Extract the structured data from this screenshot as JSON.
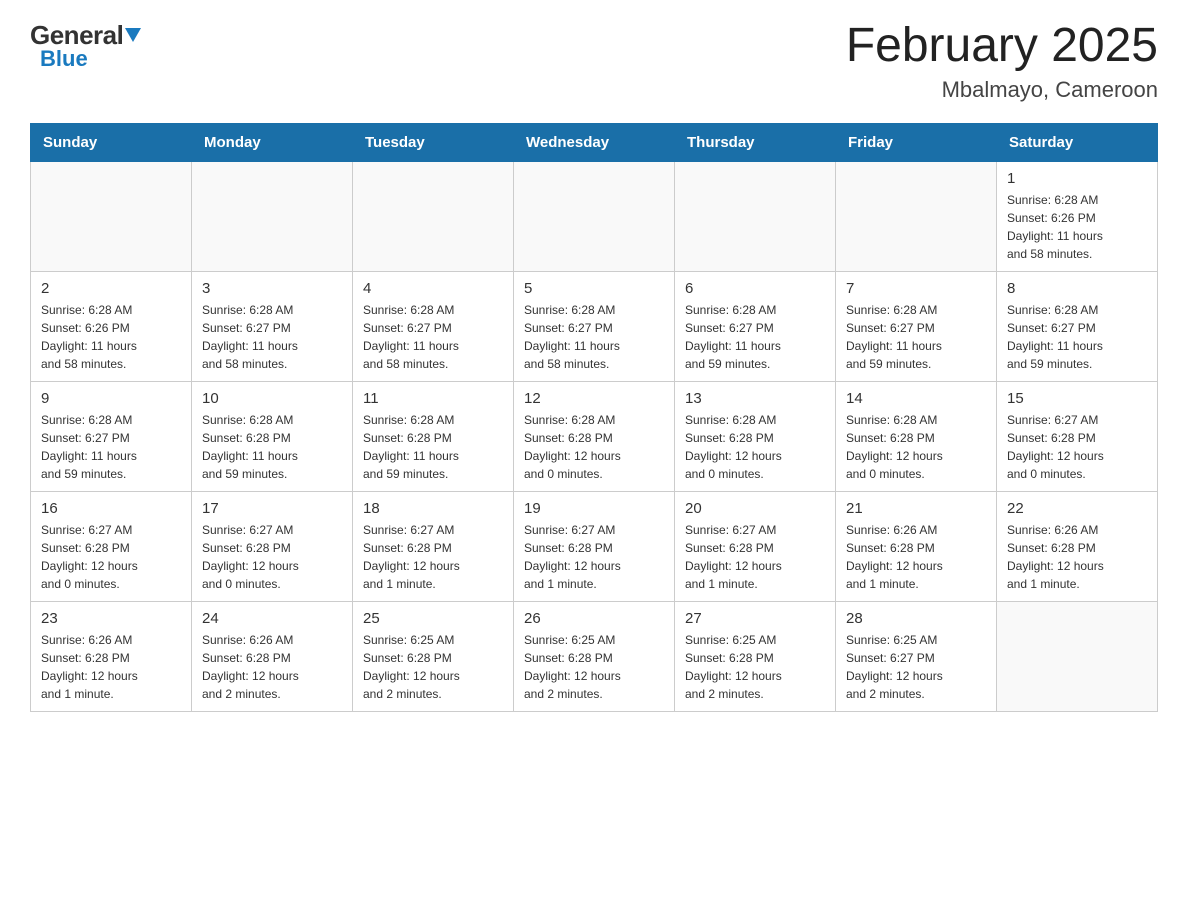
{
  "header": {
    "logo_general": "General",
    "logo_blue": "Blue",
    "title": "February 2025",
    "subtitle": "Mbalmayo, Cameroon"
  },
  "days_of_week": [
    "Sunday",
    "Monday",
    "Tuesday",
    "Wednesday",
    "Thursday",
    "Friday",
    "Saturday"
  ],
  "weeks": [
    [
      {
        "day": "",
        "info": ""
      },
      {
        "day": "",
        "info": ""
      },
      {
        "day": "",
        "info": ""
      },
      {
        "day": "",
        "info": ""
      },
      {
        "day": "",
        "info": ""
      },
      {
        "day": "",
        "info": ""
      },
      {
        "day": "1",
        "info": "Sunrise: 6:28 AM\nSunset: 6:26 PM\nDaylight: 11 hours\nand 58 minutes."
      }
    ],
    [
      {
        "day": "2",
        "info": "Sunrise: 6:28 AM\nSunset: 6:26 PM\nDaylight: 11 hours\nand 58 minutes."
      },
      {
        "day": "3",
        "info": "Sunrise: 6:28 AM\nSunset: 6:27 PM\nDaylight: 11 hours\nand 58 minutes."
      },
      {
        "day": "4",
        "info": "Sunrise: 6:28 AM\nSunset: 6:27 PM\nDaylight: 11 hours\nand 58 minutes."
      },
      {
        "day": "5",
        "info": "Sunrise: 6:28 AM\nSunset: 6:27 PM\nDaylight: 11 hours\nand 58 minutes."
      },
      {
        "day": "6",
        "info": "Sunrise: 6:28 AM\nSunset: 6:27 PM\nDaylight: 11 hours\nand 59 minutes."
      },
      {
        "day": "7",
        "info": "Sunrise: 6:28 AM\nSunset: 6:27 PM\nDaylight: 11 hours\nand 59 minutes."
      },
      {
        "day": "8",
        "info": "Sunrise: 6:28 AM\nSunset: 6:27 PM\nDaylight: 11 hours\nand 59 minutes."
      }
    ],
    [
      {
        "day": "9",
        "info": "Sunrise: 6:28 AM\nSunset: 6:27 PM\nDaylight: 11 hours\nand 59 minutes."
      },
      {
        "day": "10",
        "info": "Sunrise: 6:28 AM\nSunset: 6:28 PM\nDaylight: 11 hours\nand 59 minutes."
      },
      {
        "day": "11",
        "info": "Sunrise: 6:28 AM\nSunset: 6:28 PM\nDaylight: 11 hours\nand 59 minutes."
      },
      {
        "day": "12",
        "info": "Sunrise: 6:28 AM\nSunset: 6:28 PM\nDaylight: 12 hours\nand 0 minutes."
      },
      {
        "day": "13",
        "info": "Sunrise: 6:28 AM\nSunset: 6:28 PM\nDaylight: 12 hours\nand 0 minutes."
      },
      {
        "day": "14",
        "info": "Sunrise: 6:28 AM\nSunset: 6:28 PM\nDaylight: 12 hours\nand 0 minutes."
      },
      {
        "day": "15",
        "info": "Sunrise: 6:27 AM\nSunset: 6:28 PM\nDaylight: 12 hours\nand 0 minutes."
      }
    ],
    [
      {
        "day": "16",
        "info": "Sunrise: 6:27 AM\nSunset: 6:28 PM\nDaylight: 12 hours\nand 0 minutes."
      },
      {
        "day": "17",
        "info": "Sunrise: 6:27 AM\nSunset: 6:28 PM\nDaylight: 12 hours\nand 0 minutes."
      },
      {
        "day": "18",
        "info": "Sunrise: 6:27 AM\nSunset: 6:28 PM\nDaylight: 12 hours\nand 1 minute."
      },
      {
        "day": "19",
        "info": "Sunrise: 6:27 AM\nSunset: 6:28 PM\nDaylight: 12 hours\nand 1 minute."
      },
      {
        "day": "20",
        "info": "Sunrise: 6:27 AM\nSunset: 6:28 PM\nDaylight: 12 hours\nand 1 minute."
      },
      {
        "day": "21",
        "info": "Sunrise: 6:26 AM\nSunset: 6:28 PM\nDaylight: 12 hours\nand 1 minute."
      },
      {
        "day": "22",
        "info": "Sunrise: 6:26 AM\nSunset: 6:28 PM\nDaylight: 12 hours\nand 1 minute."
      }
    ],
    [
      {
        "day": "23",
        "info": "Sunrise: 6:26 AM\nSunset: 6:28 PM\nDaylight: 12 hours\nand 1 minute."
      },
      {
        "day": "24",
        "info": "Sunrise: 6:26 AM\nSunset: 6:28 PM\nDaylight: 12 hours\nand 2 minutes."
      },
      {
        "day": "25",
        "info": "Sunrise: 6:25 AM\nSunset: 6:28 PM\nDaylight: 12 hours\nand 2 minutes."
      },
      {
        "day": "26",
        "info": "Sunrise: 6:25 AM\nSunset: 6:28 PM\nDaylight: 12 hours\nand 2 minutes."
      },
      {
        "day": "27",
        "info": "Sunrise: 6:25 AM\nSunset: 6:28 PM\nDaylight: 12 hours\nand 2 minutes."
      },
      {
        "day": "28",
        "info": "Sunrise: 6:25 AM\nSunset: 6:27 PM\nDaylight: 12 hours\nand 2 minutes."
      },
      {
        "day": "",
        "info": ""
      }
    ]
  ]
}
